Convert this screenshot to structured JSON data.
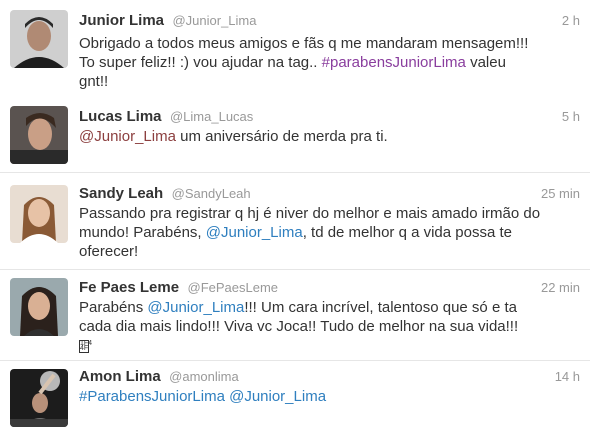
{
  "tweets": [
    {
      "name": "Junior Lima",
      "handle": "@Junior_Lima",
      "time": "2 h",
      "text1": "Obrigado a todos meus amigos e fãs q me mandaram mensagem!!!",
      "text2a": "To super feliz!! :) vou ajudar na tag.. ",
      "hashtag": "#parabensJuniorLima",
      "text2b": " valeu",
      "text3": "gnt!!"
    },
    {
      "name": "Lucas Lima",
      "handle": "@Lima_Lucas",
      "time": "5 h",
      "mention": "@Junior_Lima",
      "text": " um aniversário de merda pra ti."
    },
    {
      "name": "Sandy Leah",
      "handle": "@SandyLeah",
      "time": "25 min",
      "text1": "Passando pra registrar q hj é niver do melhor e mais amado irmão do",
      "text2a": "mundo! Parabéns, ",
      "mention": "@Junior_Lima",
      "text2b": ", td de melhor q a vida possa te",
      "text3": "oferecer!"
    },
    {
      "name": "Fe Paes Leme",
      "handle": "@FePaesLeme",
      "time": "22 min",
      "text1a": "Parabéns ",
      "mention": "@Junior_Lima",
      "text1b": "!!! Um cara incrível, talentoso que só e ta",
      "text2": "cada dia mais lindo!!! Viva vc Joca!! Tudo de melhor na sua vida!!!",
      "emoji": "1F44F"
    },
    {
      "name": "Amon Lima",
      "handle": "@amonlima",
      "time": "14 h",
      "hashtag": "#ParabensJuniorLima",
      "mention": "@Junior_Lima"
    }
  ]
}
